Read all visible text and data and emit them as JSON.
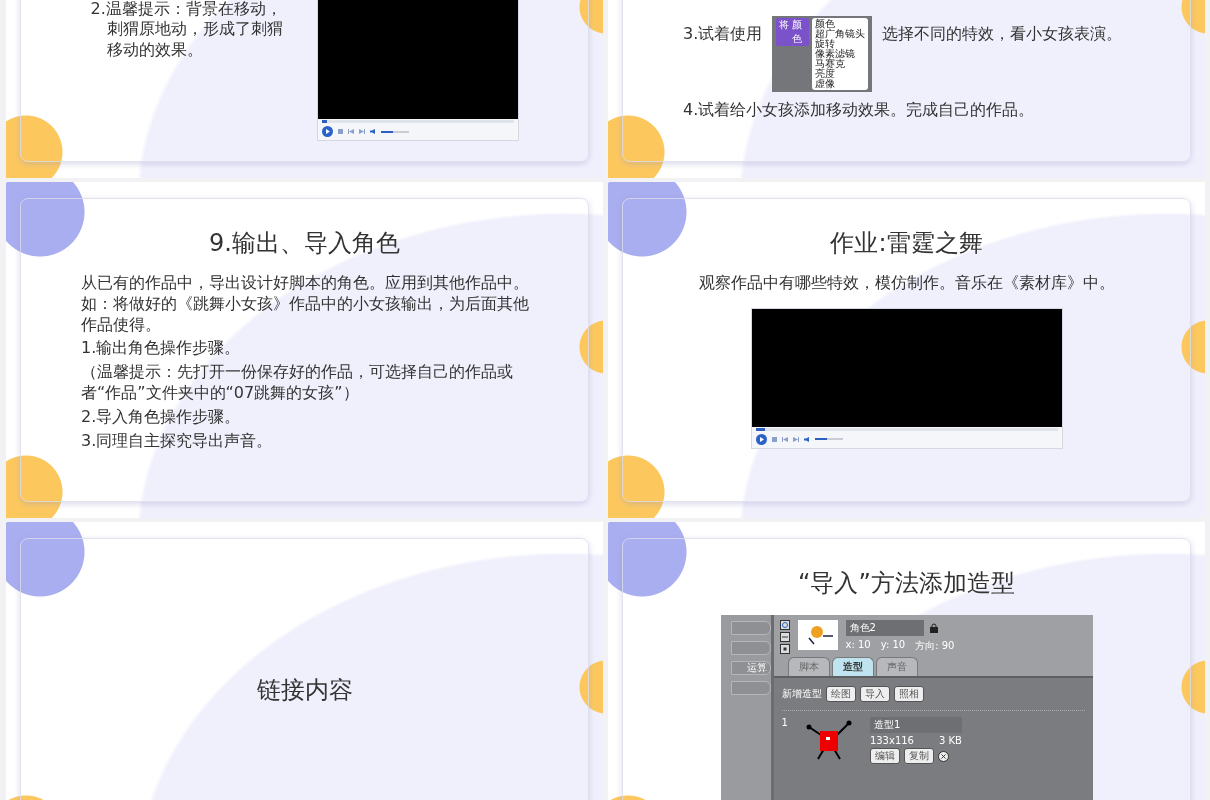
{
  "slides": [
    {
      "kind": "tip_video",
      "tip": "2.温馨提示：背景在移动，刺猬原地动，形成了刺猬移动的效果。",
      "player": {
        "seek": {
          "level": 0.03
        },
        "volume": {
          "level": 0.45
        }
      }
    },
    {
      "kind": "effect_steps",
      "step_before": "3.试着使用",
      "menu_block": [
        "将",
        "颜色"
      ],
      "menu_items": [
        "颜色",
        "超广角镜头",
        "旋转",
        "像素滤镜",
        "马赛克",
        "亮度",
        "虚像"
      ],
      "step_after": "选择不同的特效，看小女孩表演。",
      "next_step": "4.试着给小女孩添加移动效果。完成自己的作品。"
    },
    {
      "kind": "text",
      "title": "9.输出、导入角色",
      "paragraphs": [
        "从已有的作品中，导出设计好脚本的角色。应用到其他作品中。如：将做好的《跳舞小女孩》作品中的小女孩输出，为后面其他作品使得。",
        "1.输出角色操作步骤。",
        "（温馨提示：先打开一份保存好的作品，可选择自己的作品或者“作品”文件夹中的“07跳舞的女孩”）",
        "2.导入角色操作步骤。",
        "3.同理自主探究导出声音。"
      ]
    },
    {
      "kind": "video",
      "title": "作业:雷霆之舞",
      "text": "观察作品中有哪些特效，模仿制作。音乐在《素材库》中。",
      "player": {
        "seek": {
          "level": 0.03
        },
        "volume": {
          "level": 0.45
        }
      }
    },
    {
      "kind": "link",
      "text": "链接内容"
    },
    {
      "kind": "scratch",
      "title": "“导入”方法添加造型",
      "side_button": "运算",
      "sprite_name": "角色2",
      "x": "x: 10",
      "y": "y: 10",
      "direction": "方向: 90",
      "tabs": [
        {
          "label": "脚本",
          "selected": false
        },
        {
          "label": "造型",
          "selected": true
        },
        {
          "label": "声音",
          "selected": false
        }
      ],
      "new_costume": "新增造型",
      "new_buttons": [
        "绘图",
        "导入",
        "照相"
      ],
      "costume": {
        "index": "1",
        "name": "造型1",
        "size": "133x116",
        "file_size": "3 KB",
        "buttons": [
          "编辑",
          "复制"
        ]
      }
    }
  ]
}
